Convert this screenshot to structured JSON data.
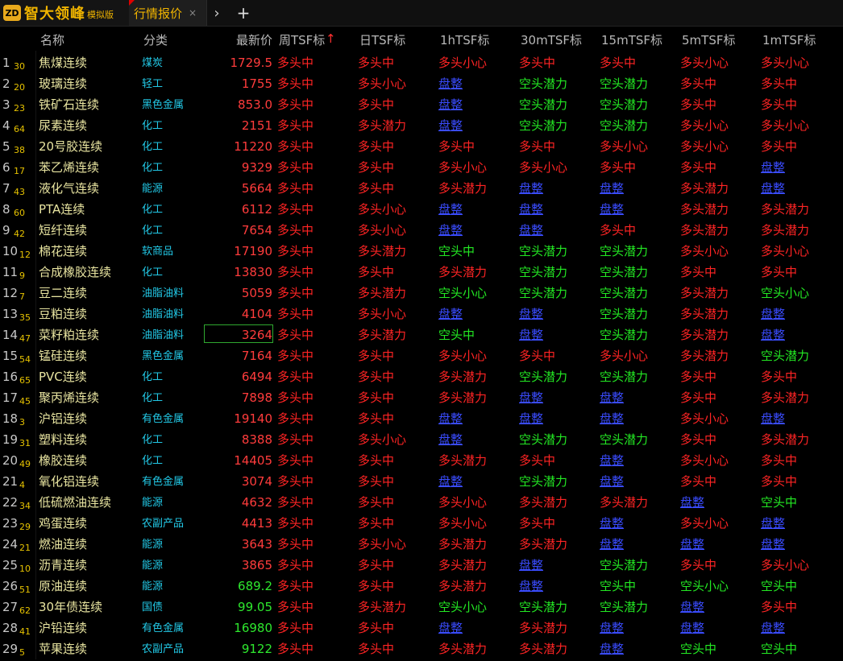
{
  "app": {
    "logo_mark": "ZD",
    "name": "智大领峰",
    "edition": "模拟版",
    "tab_label": "行情报价",
    "tab_close": "×",
    "nav_arrow": "›",
    "add_tab": "+"
  },
  "colors": {
    "bull": "#ff2424",
    "bear": "#23e823",
    "flat": "#3a4cff",
    "price_up": "#ff3c3c",
    "price_down": "#2ee82e",
    "name": "#e8e4a0",
    "category": "#22c8e6",
    "accent": "#f0b400"
  },
  "icons": {
    "sort": "arrow-up-icon",
    "close": "close-icon",
    "next": "chevron-right-icon",
    "add": "plus-icon"
  },
  "columns": [
    "名称",
    "分类",
    "最新价",
    "周TSF标",
    "日TSF标",
    "1hTSF标",
    "30mTSF标",
    "15mTSF标",
    "5mTSF标",
    "1mTSF标"
  ],
  "sort_indicator": "↑",
  "rows": [
    {
      "idx": "1",
      "sub": "30",
      "name": "焦煤连续",
      "cat": "煤炭",
      "price": "1729.5",
      "dir": "up",
      "sig": [
        "多头中",
        "多头中",
        "多头小心",
        "多头中",
        "多头中",
        "多头小心",
        "多头小心"
      ]
    },
    {
      "idx": "2",
      "sub": "20",
      "name": "玻璃连续",
      "cat": "轻工",
      "price": "1755",
      "dir": "up",
      "sig": [
        "多头中",
        "多头小心",
        "盘整",
        "空头潜力",
        "空头潜力",
        "多头中",
        "多头中"
      ]
    },
    {
      "idx": "3",
      "sub": "23",
      "name": "铁矿石连续",
      "cat": "黑色金属",
      "price": "853.0",
      "dir": "up",
      "sig": [
        "多头中",
        "多头中",
        "盘整",
        "空头潜力",
        "空头潜力",
        "多头中",
        "多头中"
      ]
    },
    {
      "idx": "4",
      "sub": "64",
      "name": "尿素连续",
      "cat": "化工",
      "price": "2151",
      "dir": "up",
      "sig": [
        "多头中",
        "多头潜力",
        "盘整",
        "空头潜力",
        "空头潜力",
        "多头小心",
        "多头小心"
      ]
    },
    {
      "idx": "5",
      "sub": "38",
      "name": "20号胶连续",
      "cat": "化工",
      "price": "11220",
      "dir": "up",
      "sig": [
        "多头中",
        "多头中",
        "多头中",
        "多头中",
        "多头小心",
        "多头小心",
        "多头中"
      ]
    },
    {
      "idx": "6",
      "sub": "17",
      "name": "苯乙烯连续",
      "cat": "化工",
      "price": "9329",
      "dir": "up",
      "sig": [
        "多头中",
        "多头中",
        "多头小心",
        "多头小心",
        "多头中",
        "多头中",
        "盘整"
      ]
    },
    {
      "idx": "7",
      "sub": "43",
      "name": "液化气连续",
      "cat": "能源",
      "price": "5664",
      "dir": "up",
      "sig": [
        "多头中",
        "多头中",
        "多头潜力",
        "盘整",
        "盘整",
        "多头潜力",
        "盘整"
      ]
    },
    {
      "idx": "8",
      "sub": "60",
      "name": "PTA连续",
      "cat": "化工",
      "price": "6112",
      "dir": "up",
      "sig": [
        "多头中",
        "多头小心",
        "盘整",
        "盘整",
        "盘整",
        "多头潜力",
        "多头潜力"
      ]
    },
    {
      "idx": "9",
      "sub": "42",
      "name": "短纤连续",
      "cat": "化工",
      "price": "7654",
      "dir": "up",
      "sig": [
        "多头中",
        "多头小心",
        "盘整",
        "盘整",
        "多头中",
        "多头潜力",
        "多头潜力"
      ]
    },
    {
      "idx": "10",
      "sub": "12",
      "name": "棉花连续",
      "cat": "软商品",
      "price": "17190",
      "dir": "up",
      "sig": [
        "多头中",
        "多头潜力",
        "空头中",
        "空头潜力",
        "空头潜力",
        "多头小心",
        "多头小心"
      ]
    },
    {
      "idx": "11",
      "sub": "9",
      "name": "合成橡胶连续",
      "cat": "化工",
      "price": "13830",
      "dir": "up",
      "sig": [
        "多头中",
        "多头中",
        "多头潜力",
        "空头潜力",
        "空头潜力",
        "多头中",
        "多头中"
      ]
    },
    {
      "idx": "12",
      "sub": "7",
      "name": "豆二连续",
      "cat": "油脂油料",
      "price": "5059",
      "dir": "up",
      "sig": [
        "多头中",
        "多头潜力",
        "空头小心",
        "空头潜力",
        "空头潜力",
        "多头潜力",
        "空头小心"
      ]
    },
    {
      "idx": "13",
      "sub": "35",
      "name": "豆粕连续",
      "cat": "油脂油料",
      "price": "4104",
      "dir": "up",
      "sig": [
        "多头中",
        "多头小心",
        "盘整",
        "盘整",
        "空头潜力",
        "多头潜力",
        "盘整"
      ]
    },
    {
      "idx": "14",
      "sub": "47",
      "name": "菜籽粕连续",
      "cat": "油脂油料",
      "price": "3264",
      "dir": "up",
      "boxed": true,
      "sig": [
        "多头中",
        "多头潜力",
        "空头中",
        "盘整",
        "空头潜力",
        "多头潜力",
        "盘整"
      ]
    },
    {
      "idx": "15",
      "sub": "54",
      "name": "锰硅连续",
      "cat": "黑色金属",
      "price": "7164",
      "dir": "up",
      "sig": [
        "多头中",
        "多头中",
        "多头小心",
        "多头中",
        "多头小心",
        "多头潜力",
        "空头潜力"
      ]
    },
    {
      "idx": "16",
      "sub": "65",
      "name": "PVC连续",
      "cat": "化工",
      "price": "6494",
      "dir": "up",
      "sig": [
        "多头中",
        "多头中",
        "多头潜力",
        "空头潜力",
        "空头潜力",
        "多头中",
        "多头中"
      ]
    },
    {
      "idx": "17",
      "sub": "45",
      "name": "聚丙烯连续",
      "cat": "化工",
      "price": "7898",
      "dir": "up",
      "sig": [
        "多头中",
        "多头中",
        "多头潜力",
        "盘整",
        "盘整",
        "多头中",
        "多头潜力"
      ]
    },
    {
      "idx": "18",
      "sub": "3",
      "name": "沪铝连续",
      "cat": "有色金属",
      "price": "19140",
      "dir": "up",
      "sig": [
        "多头中",
        "多头中",
        "盘整",
        "盘整",
        "盘整",
        "多头小心",
        "盘整"
      ]
    },
    {
      "idx": "19",
      "sub": "31",
      "name": "塑料连续",
      "cat": "化工",
      "price": "8388",
      "dir": "up",
      "sig": [
        "多头中",
        "多头小心",
        "盘整",
        "空头潜力",
        "空头潜力",
        "多头中",
        "多头潜力"
      ]
    },
    {
      "idx": "20",
      "sub": "49",
      "name": "橡胶连续",
      "cat": "化工",
      "price": "14405",
      "dir": "up",
      "sig": [
        "多头中",
        "多头中",
        "多头潜力",
        "多头中",
        "盘整",
        "多头小心",
        "多头中"
      ]
    },
    {
      "idx": "21",
      "sub": "4",
      "name": "氧化铝连续",
      "cat": "有色金属",
      "price": "3074",
      "dir": "up",
      "sig": [
        "多头中",
        "多头中",
        "盘整",
        "空头潜力",
        "盘整",
        "多头中",
        "多头中"
      ]
    },
    {
      "idx": "22",
      "sub": "34",
      "name": "低硫燃油连续",
      "cat": "能源",
      "price": "4632",
      "dir": "up",
      "sig": [
        "多头中",
        "多头中",
        "多头小心",
        "多头潜力",
        "多头潜力",
        "盘整",
        "空头中"
      ]
    },
    {
      "idx": "23",
      "sub": "29",
      "name": "鸡蛋连续",
      "cat": "农副产品",
      "price": "4413",
      "dir": "up",
      "sig": [
        "多头中",
        "多头中",
        "多头小心",
        "多头中",
        "盘整",
        "多头小心",
        "盘整"
      ]
    },
    {
      "idx": "24",
      "sub": "21",
      "name": "燃油连续",
      "cat": "能源",
      "price": "3643",
      "dir": "up",
      "sig": [
        "多头中",
        "多头小心",
        "多头潜力",
        "多头潜力",
        "盘整",
        "盘整",
        "盘整"
      ]
    },
    {
      "idx": "25",
      "sub": "10",
      "name": "沥青连续",
      "cat": "能源",
      "price": "3865",
      "dir": "up",
      "sig": [
        "多头中",
        "多头中",
        "多头潜力",
        "盘整",
        "空头潜力",
        "多头中",
        "多头小心"
      ]
    },
    {
      "idx": "26",
      "sub": "51",
      "name": "原油连续",
      "cat": "能源",
      "price": "689.2",
      "dir": "down",
      "sig": [
        "多头中",
        "多头中",
        "多头潜力",
        "盘整",
        "空头中",
        "空头小心",
        "空头中"
      ]
    },
    {
      "idx": "27",
      "sub": "62",
      "name": "30年债连续",
      "cat": "国债",
      "price": "99.05",
      "dir": "down",
      "sig": [
        "多头中",
        "多头潜力",
        "空头小心",
        "空头潜力",
        "空头潜力",
        "盘整",
        "多头中"
      ]
    },
    {
      "idx": "28",
      "sub": "41",
      "name": "沪铅连续",
      "cat": "有色金属",
      "price": "16980",
      "dir": "down",
      "sig": [
        "多头中",
        "多头中",
        "盘整",
        "多头潜力",
        "盘整",
        "盘整",
        "盘整"
      ]
    },
    {
      "idx": "29",
      "sub": "5",
      "name": "苹果连续",
      "cat": "农副产品",
      "price": "9122",
      "dir": "down",
      "sig": [
        "多头中",
        "多头中",
        "多头潜力",
        "多头潜力",
        "盘整",
        "空头中",
        "空头中"
      ]
    }
  ]
}
